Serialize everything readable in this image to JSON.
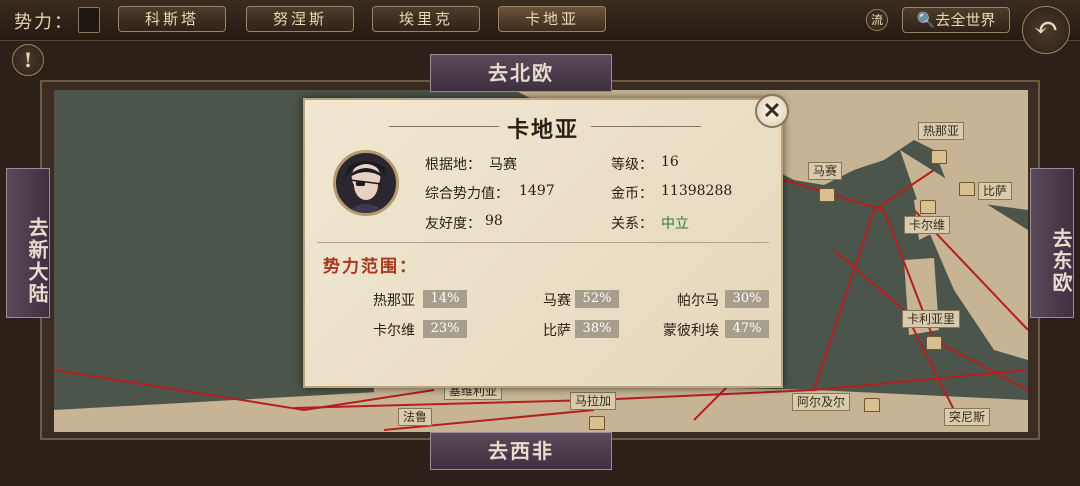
{
  "top": {
    "faction_label": "势力：",
    "tabs": [
      "科斯塔",
      "努涅斯",
      "埃里克",
      "卡地亚"
    ],
    "flow_icon_label": "流",
    "world_button": "去全世界"
  },
  "nav": {
    "north": "去北欧",
    "south": "去西非",
    "west": "去新大陆",
    "east": "去东欧"
  },
  "map_labels": {
    "genoa": "热那亚",
    "marseille": "马赛",
    "pisa": "比萨",
    "cagliari": "卡尔维",
    "caglia_li": "卡利亚里",
    "seville": "塞维利亚",
    "faro": "法鲁",
    "malaga": "马拉加",
    "algiers": "阿尔及尔",
    "tunis": "突尼斯"
  },
  "dialog": {
    "title": "卡地亚",
    "base_label": "根据地：",
    "base_value": "马赛",
    "level_label": "等级：",
    "level_value": "16",
    "power_label": "综合势力值：",
    "power_value": "1497",
    "gold_label": "金币：",
    "gold_value": "11398288",
    "friend_label": "友好度：",
    "friend_value": "98",
    "relation_label": "关系：",
    "relation_value": "中立",
    "range_title": "势力范围：",
    "ranges": [
      {
        "city": "热那亚",
        "pct": "14%"
      },
      {
        "city": "马赛",
        "pct": "52%"
      },
      {
        "city": "帕尔马",
        "pct": "30%"
      },
      {
        "city": "卡尔维",
        "pct": "23%"
      },
      {
        "city": "比萨",
        "pct": "38%"
      },
      {
        "city": "蒙彼利埃",
        "pct": "47%"
      }
    ]
  }
}
